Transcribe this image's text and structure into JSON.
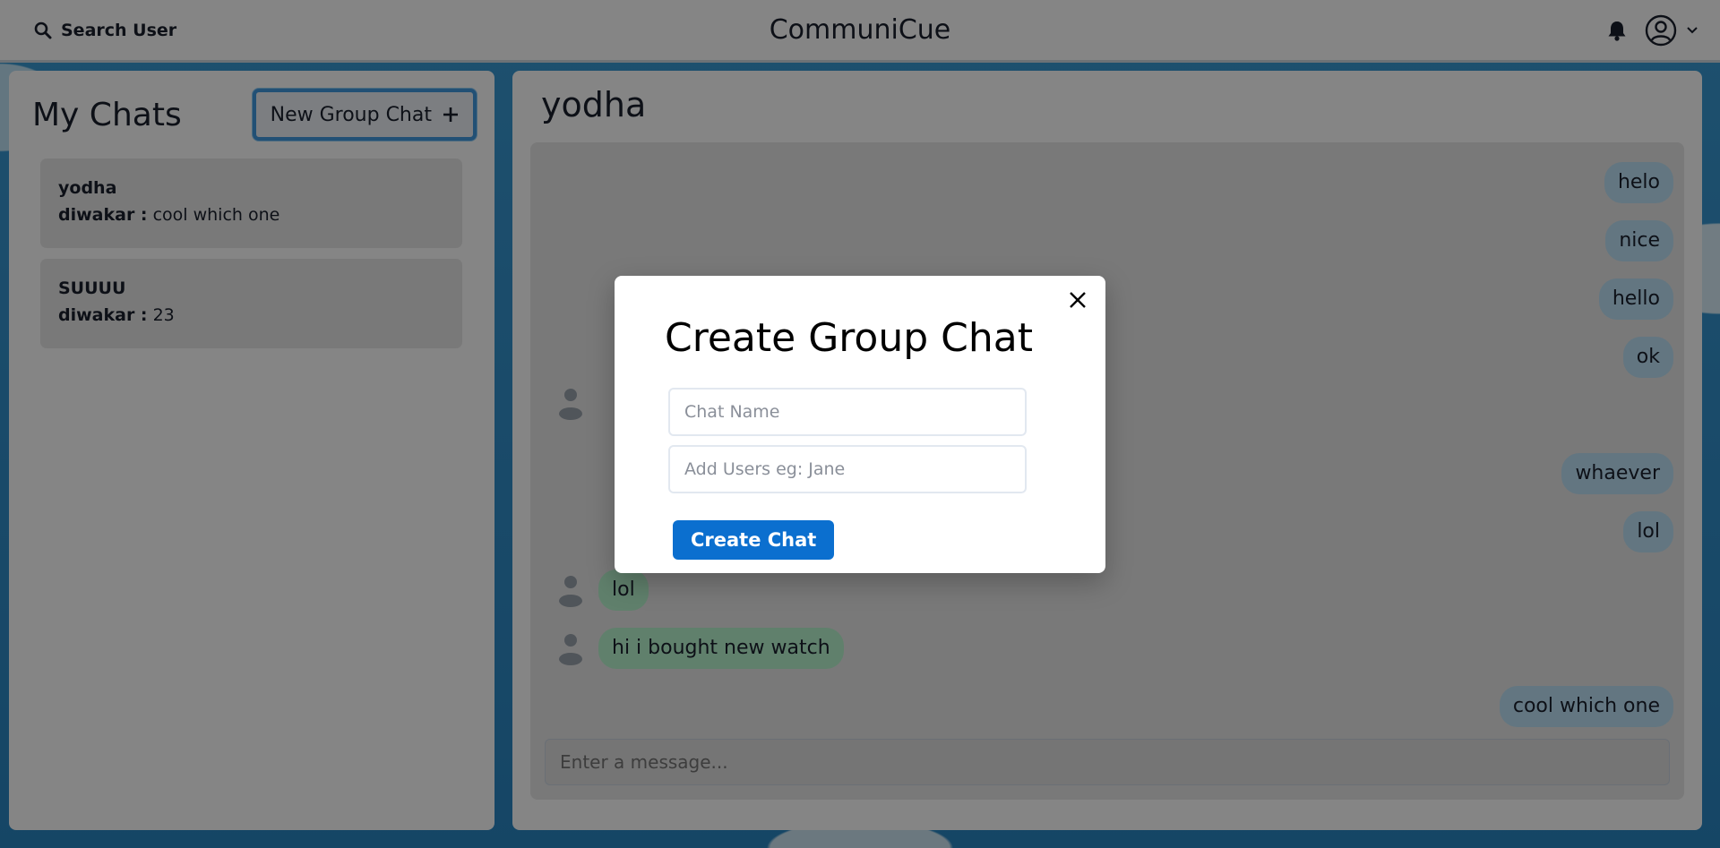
{
  "header": {
    "search_label": "Search User",
    "app_title": "CommuniCue"
  },
  "sidebar": {
    "title": "My Chats",
    "new_group_label": "New Group Chat",
    "chats": [
      {
        "name": "yodha",
        "sender": "diwakar :",
        "latest": "cool which one"
      },
      {
        "name": "SUUUU",
        "sender": "diwakar :",
        "latest": "23"
      }
    ]
  },
  "chat": {
    "title": "yodha",
    "messages": [
      {
        "text": "helo",
        "side": "right"
      },
      {
        "text": "nice",
        "side": "right"
      },
      {
        "text": "hello",
        "side": "right"
      },
      {
        "text": "ok",
        "side": "right"
      },
      {
        "text": "whaever",
        "side": "right"
      },
      {
        "text": "lol",
        "side": "right"
      },
      {
        "text": "lol",
        "side": "left"
      },
      {
        "text": "hi i bought new watch",
        "side": "left"
      },
      {
        "text": "cool which one",
        "side": "right"
      }
    ],
    "input_placeholder": "Enter a message..."
  },
  "modal": {
    "title": "Create Group Chat",
    "chat_name_placeholder": "Chat Name",
    "add_users_placeholder": "Add Users eg: Jane",
    "create_label": "Create Chat"
  },
  "colors": {
    "my_bubble": "#bee3f8",
    "other_bubble": "#b9f5d0",
    "primary_button": "#0b6fcf",
    "focus_ring": "#4299e1"
  },
  "icons": [
    "search-icon",
    "bell-icon",
    "user-avatar-icon",
    "chevron-down-icon",
    "plus-icon",
    "close-icon",
    "sender-avatar-icon"
  ]
}
